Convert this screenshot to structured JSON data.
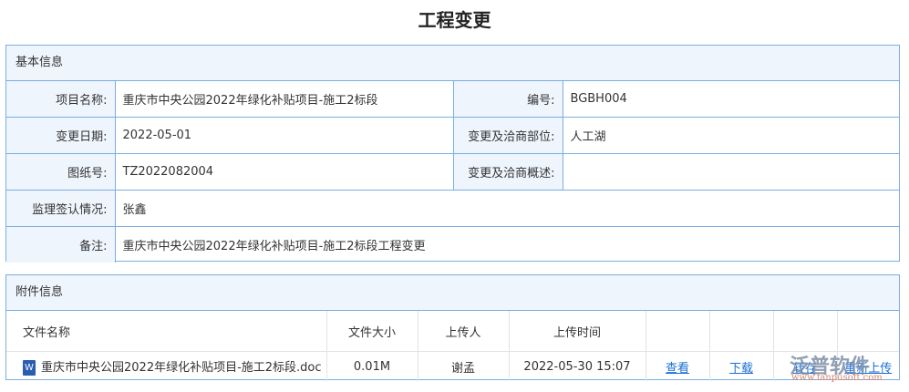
{
  "title": "工程变更",
  "basic": {
    "header": "基本信息",
    "project_name_label": "项目名称:",
    "project_name": "重庆市中央公园2022年绿化补贴项目-施工2标段",
    "code_label": "编号:",
    "code": "BGBH004",
    "date_label": "变更日期:",
    "date": "2022-05-01",
    "part_label": "变更及洽商部位:",
    "part": "人工湖",
    "drawing_label": "图纸号:",
    "drawing": "TZ2022082004",
    "summary_label": "变更及洽商概述:",
    "summary": "",
    "supervisor_label": "监理签认情况:",
    "supervisor": "张鑫",
    "remark_label": "备注:",
    "remark": "重庆市中央公园2022年绿化补贴项目-施工2标段工程变更"
  },
  "attachments": {
    "header": "附件信息",
    "columns": [
      "文件名称",
      "文件大小",
      "上传人",
      "上传时间"
    ],
    "rows": [
      {
        "file": "重庆市中央公园2022年绿化补贴项目-施工2标段.doc",
        "size": "0.01M",
        "uploader": "谢孟",
        "time": "2022-05-30 15:07",
        "actions": [
          "查看",
          "下载",
          "转存",
          "重新上传"
        ]
      }
    ]
  },
  "watermark": {
    "brand": "泛普软件",
    "url": "www.fanpusoft.com"
  }
}
